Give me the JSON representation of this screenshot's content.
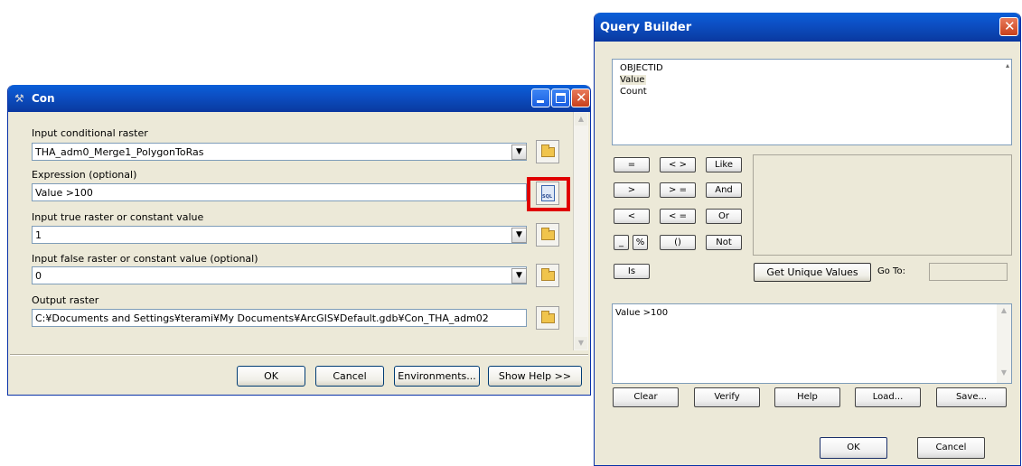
{
  "con": {
    "title": "Con",
    "fields": {
      "input_conditional_label": "Input conditional raster",
      "input_conditional_value": "THA_adm0_Merge1_PolygonToRas",
      "expression_label": "Expression (optional)",
      "expression_value": "Value >100",
      "true_label": "Input true raster or constant value",
      "true_value": "1",
      "false_label": "Input false raster or constant value (optional)",
      "false_value": "0",
      "output_label": "Output raster",
      "output_value": "C:¥Documents and Settings¥terami¥My Documents¥ArcGIS¥Default.gdb¥Con_THA_adm02"
    },
    "buttons": {
      "ok": "OK",
      "cancel": "Cancel",
      "environments": "Environments...",
      "show_help": "Show Help >>"
    },
    "sql_icon_text": "SQL",
    "highlight_color": "#e00000"
  },
  "query_builder": {
    "title": "Query Builder",
    "fields": [
      "OBJECTID",
      "Value",
      "Count"
    ],
    "operators": {
      "eq": "=",
      "ne": "< >",
      "like": "Like",
      "gt": ">",
      "ge": "> =",
      "and": "And",
      "lt": "<",
      "le": "< =",
      "or": "Or",
      "underscore": "_",
      "percent": "%",
      "parens": "()",
      "not": "Not",
      "is": "Is"
    },
    "get_unique_values": "Get Unique Values",
    "go_to_label": "Go To:",
    "expression_text": "Value >100",
    "buttons": {
      "clear": "Clear",
      "verify": "Verify",
      "help": "Help",
      "load": "Load...",
      "save": "Save...",
      "ok": "OK",
      "cancel": "Cancel"
    }
  }
}
